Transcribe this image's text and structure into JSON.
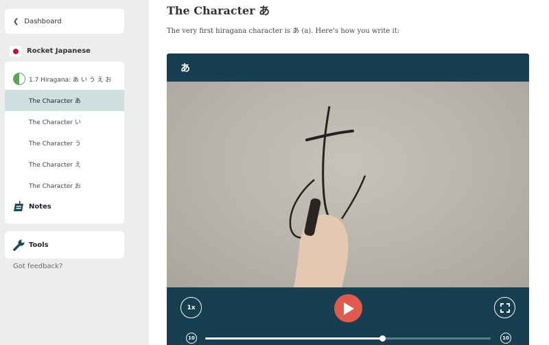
{
  "sidebar": {
    "back_label": "Dashboard",
    "course_name": "Rocket Japanese",
    "lesson": {
      "title": "1.7 Hiragana: あ い う え お",
      "progress": 0.5,
      "items": [
        {
          "label": "The Character あ",
          "active": true
        },
        {
          "label": "The Character い",
          "active": false
        },
        {
          "label": "The Character う",
          "active": false
        },
        {
          "label": "The Character え",
          "active": false
        },
        {
          "label": "The Character お",
          "active": false
        }
      ],
      "notes_label": "Notes"
    },
    "tools_label": "Tools",
    "feedback_label": "Got feedback?"
  },
  "main": {
    "title": "The Character あ",
    "intro": "The very first hiragana character is あ (a). Here’s how you write it:",
    "player": {
      "header": "あ",
      "speed_label": "1x",
      "skip_back_label": "10",
      "skip_forward_label": "10",
      "progress": 0.62,
      "colors": {
        "bar": "#173f4f",
        "play": "#e05a50"
      }
    }
  }
}
